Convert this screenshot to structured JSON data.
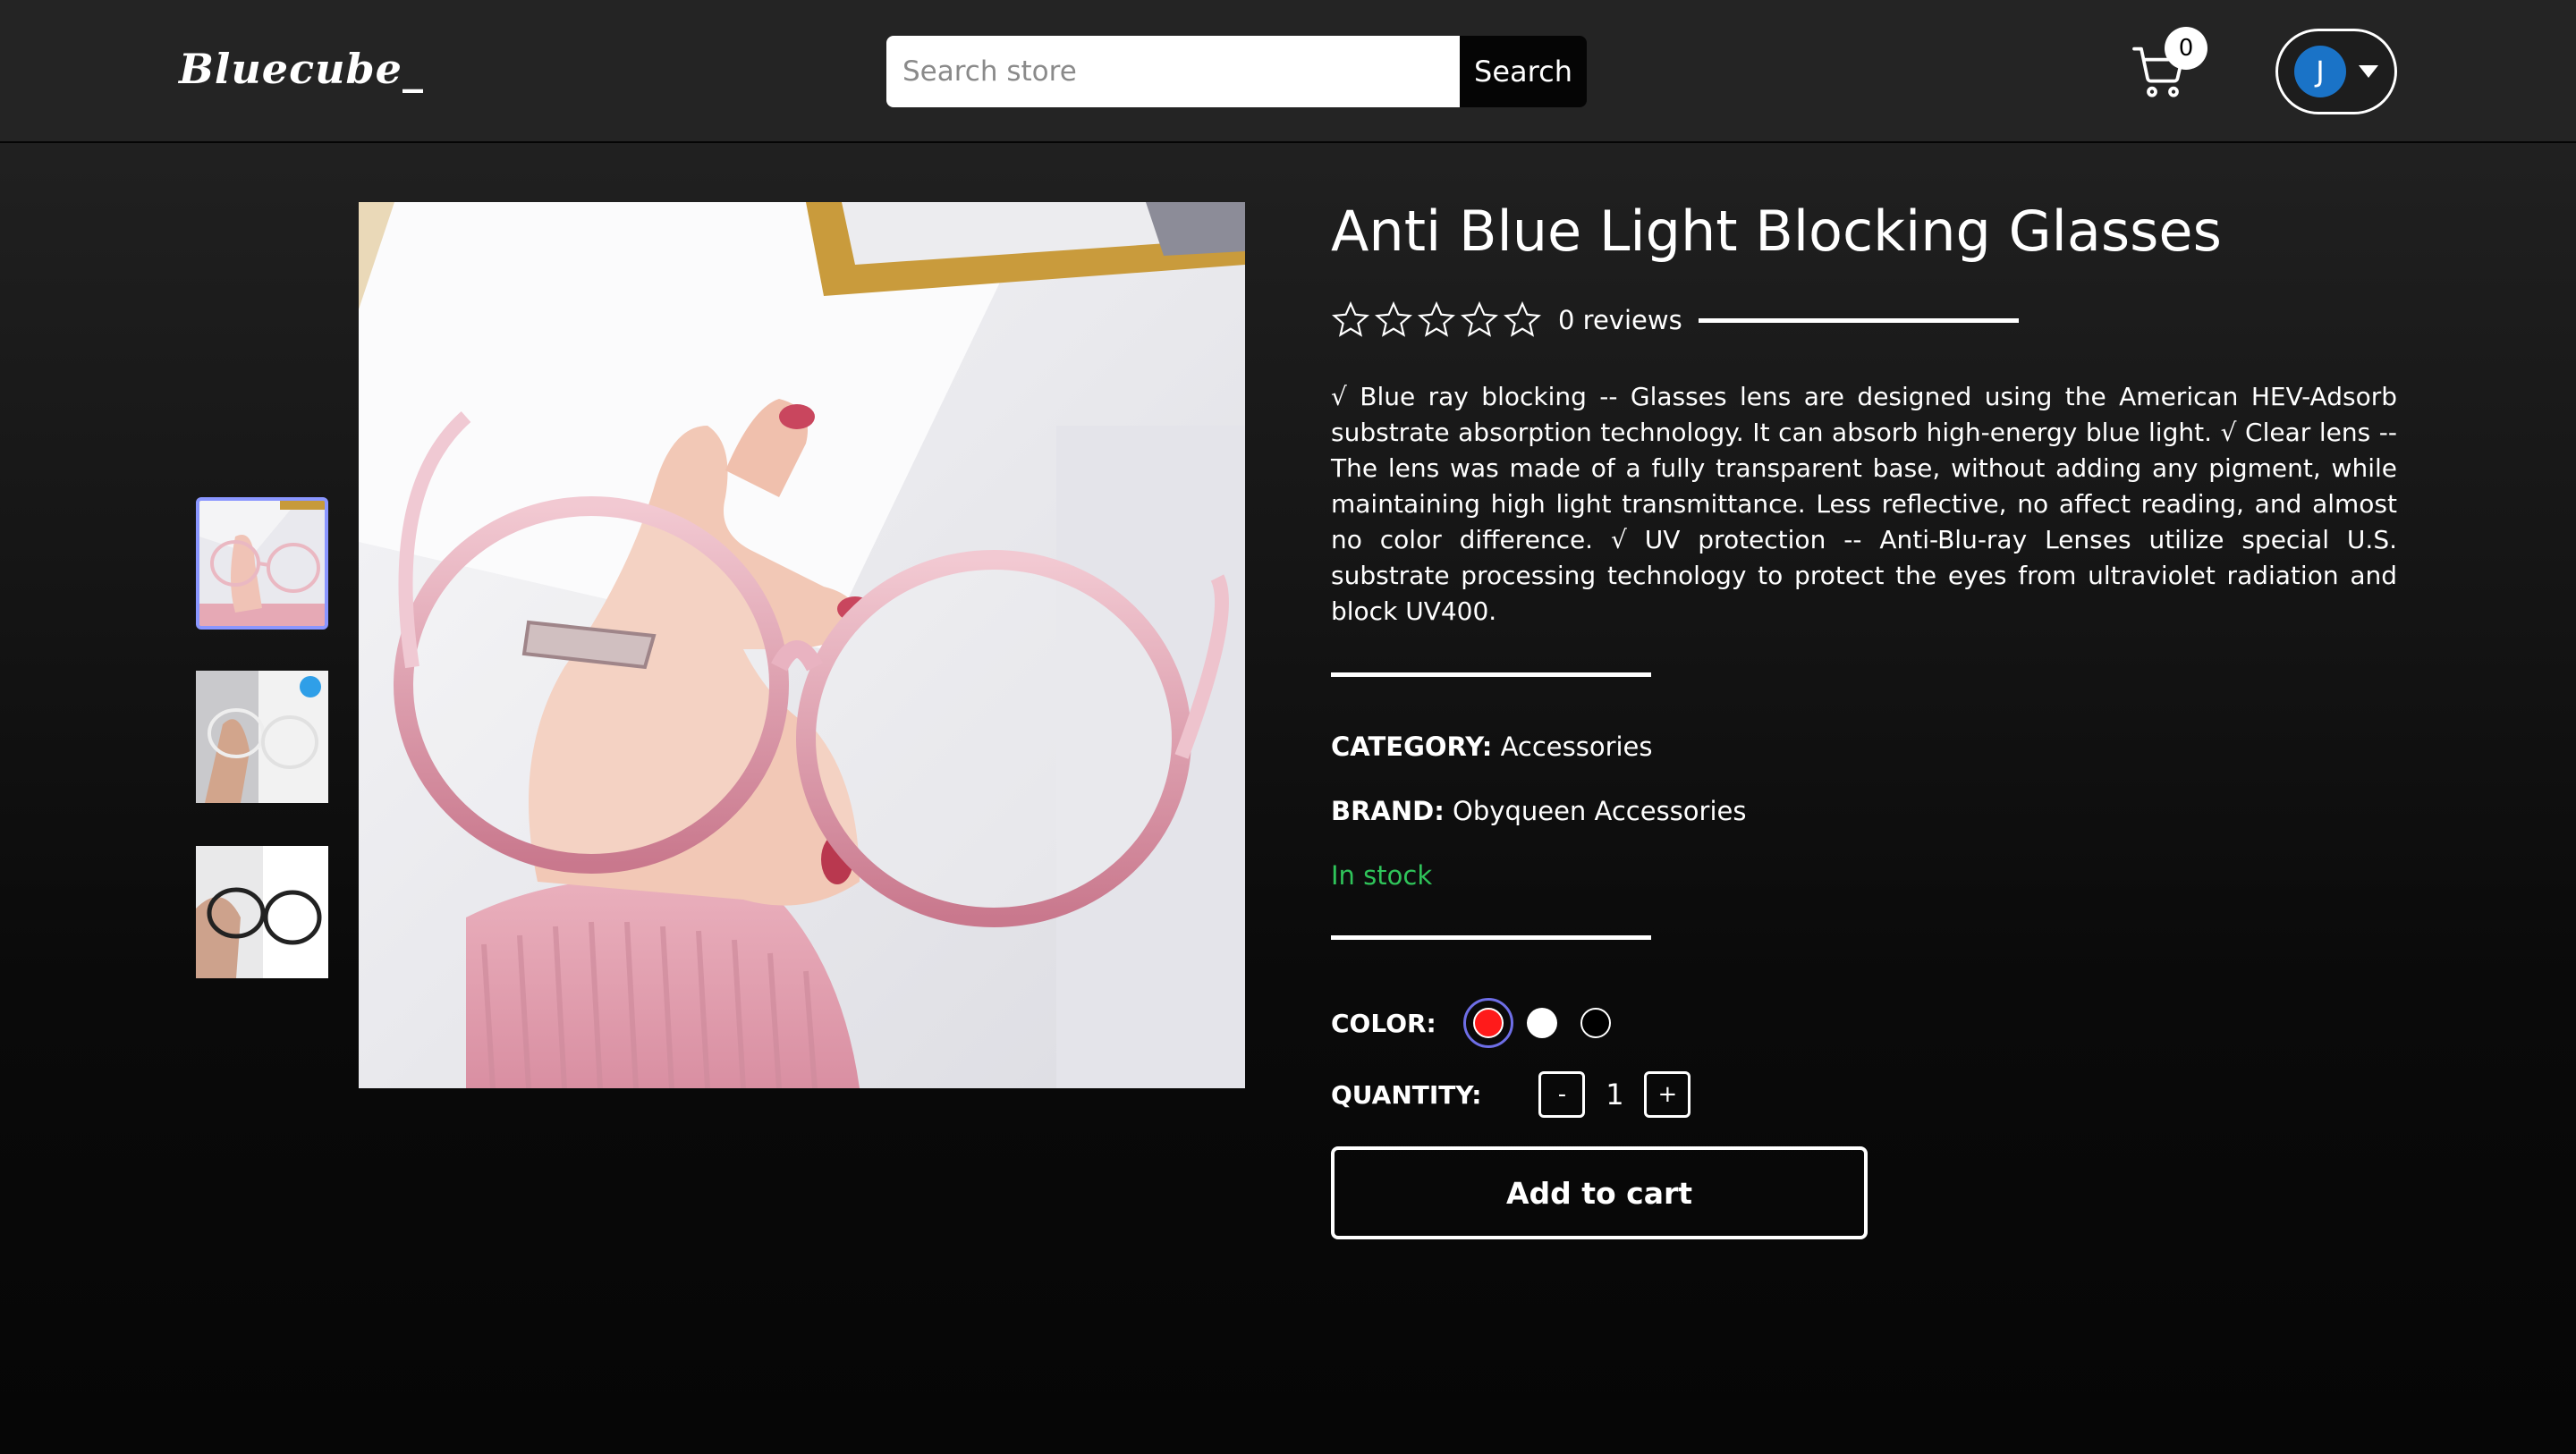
{
  "header": {
    "logo": "Bluecube_",
    "search": {
      "placeholder": "Search store",
      "value": "",
      "button_label": "Search"
    },
    "cart": {
      "icon": "cart-icon",
      "count": "0"
    },
    "user": {
      "initial": "J",
      "avatar_color": "#1a73c7",
      "menu_icon": "caret-down-icon"
    }
  },
  "gallery": {
    "thumbnails": [
      {
        "name": "pink-frame-glasses-in-hand",
        "selected": true
      },
      {
        "name": "clear-glasses-on-case",
        "selected": false
      },
      {
        "name": "black-frame-glasses-on-case",
        "selected": false
      }
    ],
    "main_image": "pink-frame-glasses-in-hand"
  },
  "product": {
    "title": "Anti Blue Light Blocking Glasses",
    "rating": {
      "stars": 0,
      "max": 5,
      "reviews_label": "0 reviews"
    },
    "description": "√ Blue ray blocking -- Glasses lens are designed using the American HEV-Adsorb substrate absorption technology. It can absorb high-energy blue light. √ Clear lens -- The lens was made of a fully transparent base, without adding any pigment, while maintaining high light transmittance. Less reflective, no affect reading, and almost no color difference. √ UV protection -- Anti-Blu-ray Lenses utilize special U.S. substrate processing technology to protect the eyes from ultraviolet radiation and block UV400.",
    "category_label": "CATEGORY:",
    "category": "Accessories",
    "brand_label": "BRAND:",
    "brand": "Obyqueen Accessories",
    "stock": "In stock",
    "stock_color": "#2fc45a",
    "color_label": "COLOR:",
    "colors": [
      {
        "name": "red",
        "hex": "#ff1a1a",
        "selected": true
      },
      {
        "name": "white",
        "hex": "#ffffff",
        "selected": false
      },
      {
        "name": "black",
        "hex": "#000000",
        "selected": false
      }
    ],
    "quantity_label": "QUANTITY:",
    "quantity": "1",
    "decrement_label": "-",
    "increment_label": "+",
    "add_to_cart_label": "Add to cart"
  }
}
